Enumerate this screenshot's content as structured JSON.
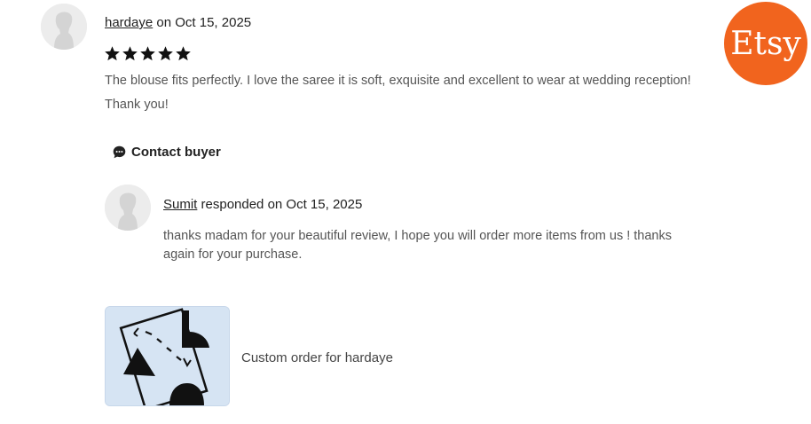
{
  "review": {
    "reviewer_name": "hardaye",
    "date_text": " on Oct 15, 2025",
    "rating": 5,
    "rating_max": 5,
    "text_line1": "The blouse fits perfectly. I love the saree it is soft, exquisite and excellent to wear at wedding reception!",
    "text_line2": "Thank you!"
  },
  "contact_buyer": {
    "label": "Contact buyer",
    "icon": "chat-bubble-icon"
  },
  "response": {
    "responder_name": "Sumit",
    "date_text": " responded on Oct 15, 2025",
    "text_line1": "thanks madam for your beautiful review, I hope you will order more items from us ! thanks",
    "text_line2": "again for your purchase."
  },
  "listing": {
    "title": "Custom order for hardaye",
    "thumbnail_icon": "custom-order-placeholder-icon"
  },
  "brand": {
    "logo_text": "Etsy",
    "color": "#f1641e"
  }
}
